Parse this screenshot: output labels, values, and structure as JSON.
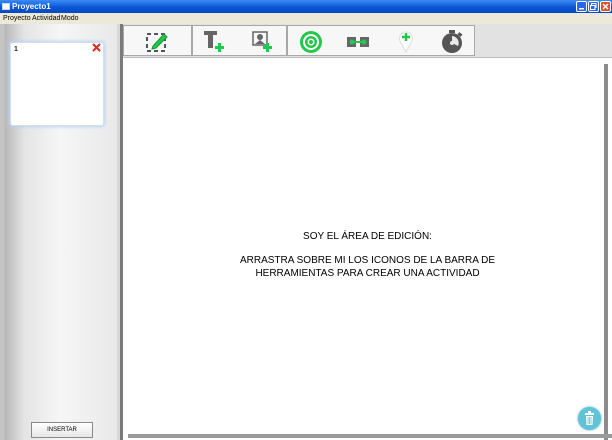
{
  "window": {
    "title": "Proyecto1"
  },
  "menu": {
    "items": [
      "Proyecto",
      "Actividad",
      "Modo"
    ]
  },
  "sidebar": {
    "slides": [
      {
        "number": "1"
      }
    ],
    "insert_label": "INSERTAR"
  },
  "toolbar": {
    "groups": [
      {
        "tools": [
          "edit-area-icon"
        ]
      },
      {
        "tools": [
          "add-text-icon",
          "add-image-icon"
        ]
      },
      {
        "tools": [
          "target-icon",
          "connect-icon",
          "marker-icon",
          "timer-icon"
        ]
      }
    ]
  },
  "canvas": {
    "line1": "SOY EL ÁREA DE EDICIÓN:",
    "line2": "ARRASTRA SOBRE MI LOS ICONOS DE LA BARRA DE",
    "line3": "HERRAMIENTAS PARA CREAR UNA ACTIVIDAD"
  },
  "colors": {
    "titlebar": "#0a56d8",
    "accent_green": "#22c84a",
    "trash": "#5fc4d8"
  }
}
